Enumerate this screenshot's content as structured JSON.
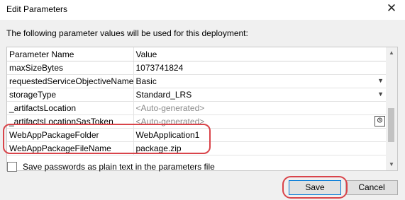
{
  "window": {
    "title": "Edit Parameters",
    "close_glyph": "✕"
  },
  "intro": "The following parameter values will be used for this deployment:",
  "table": {
    "headers": [
      "Parameter Name",
      "Value"
    ],
    "rows": [
      {
        "name": "maxSizeBytes",
        "value": "1073741824"
      },
      {
        "name": "requestedServiceObjectiveName",
        "value": "Basic"
      },
      {
        "name": "storageType",
        "value": "Standard_LRS"
      },
      {
        "name": "_artifactsLocation",
        "value": "<Auto-generated>"
      },
      {
        "name": "_artifactsLocationSasToken",
        "value": "<Auto-generated>"
      },
      {
        "name": "WebAppPackageFolder",
        "value": "WebApplication1"
      },
      {
        "name": "WebAppPackageFileName",
        "value": "package.zip"
      }
    ]
  },
  "checkbox_label": "Save passwords as plain text in the parameters file",
  "buttons": {
    "save": "Save",
    "cancel": "Cancel"
  },
  "icons": {
    "dropdown": "▼",
    "scroll_up": "▲",
    "scroll_down": "▼"
  },
  "colors": {
    "highlight": "#d9444a",
    "accent": "#0078d7"
  }
}
